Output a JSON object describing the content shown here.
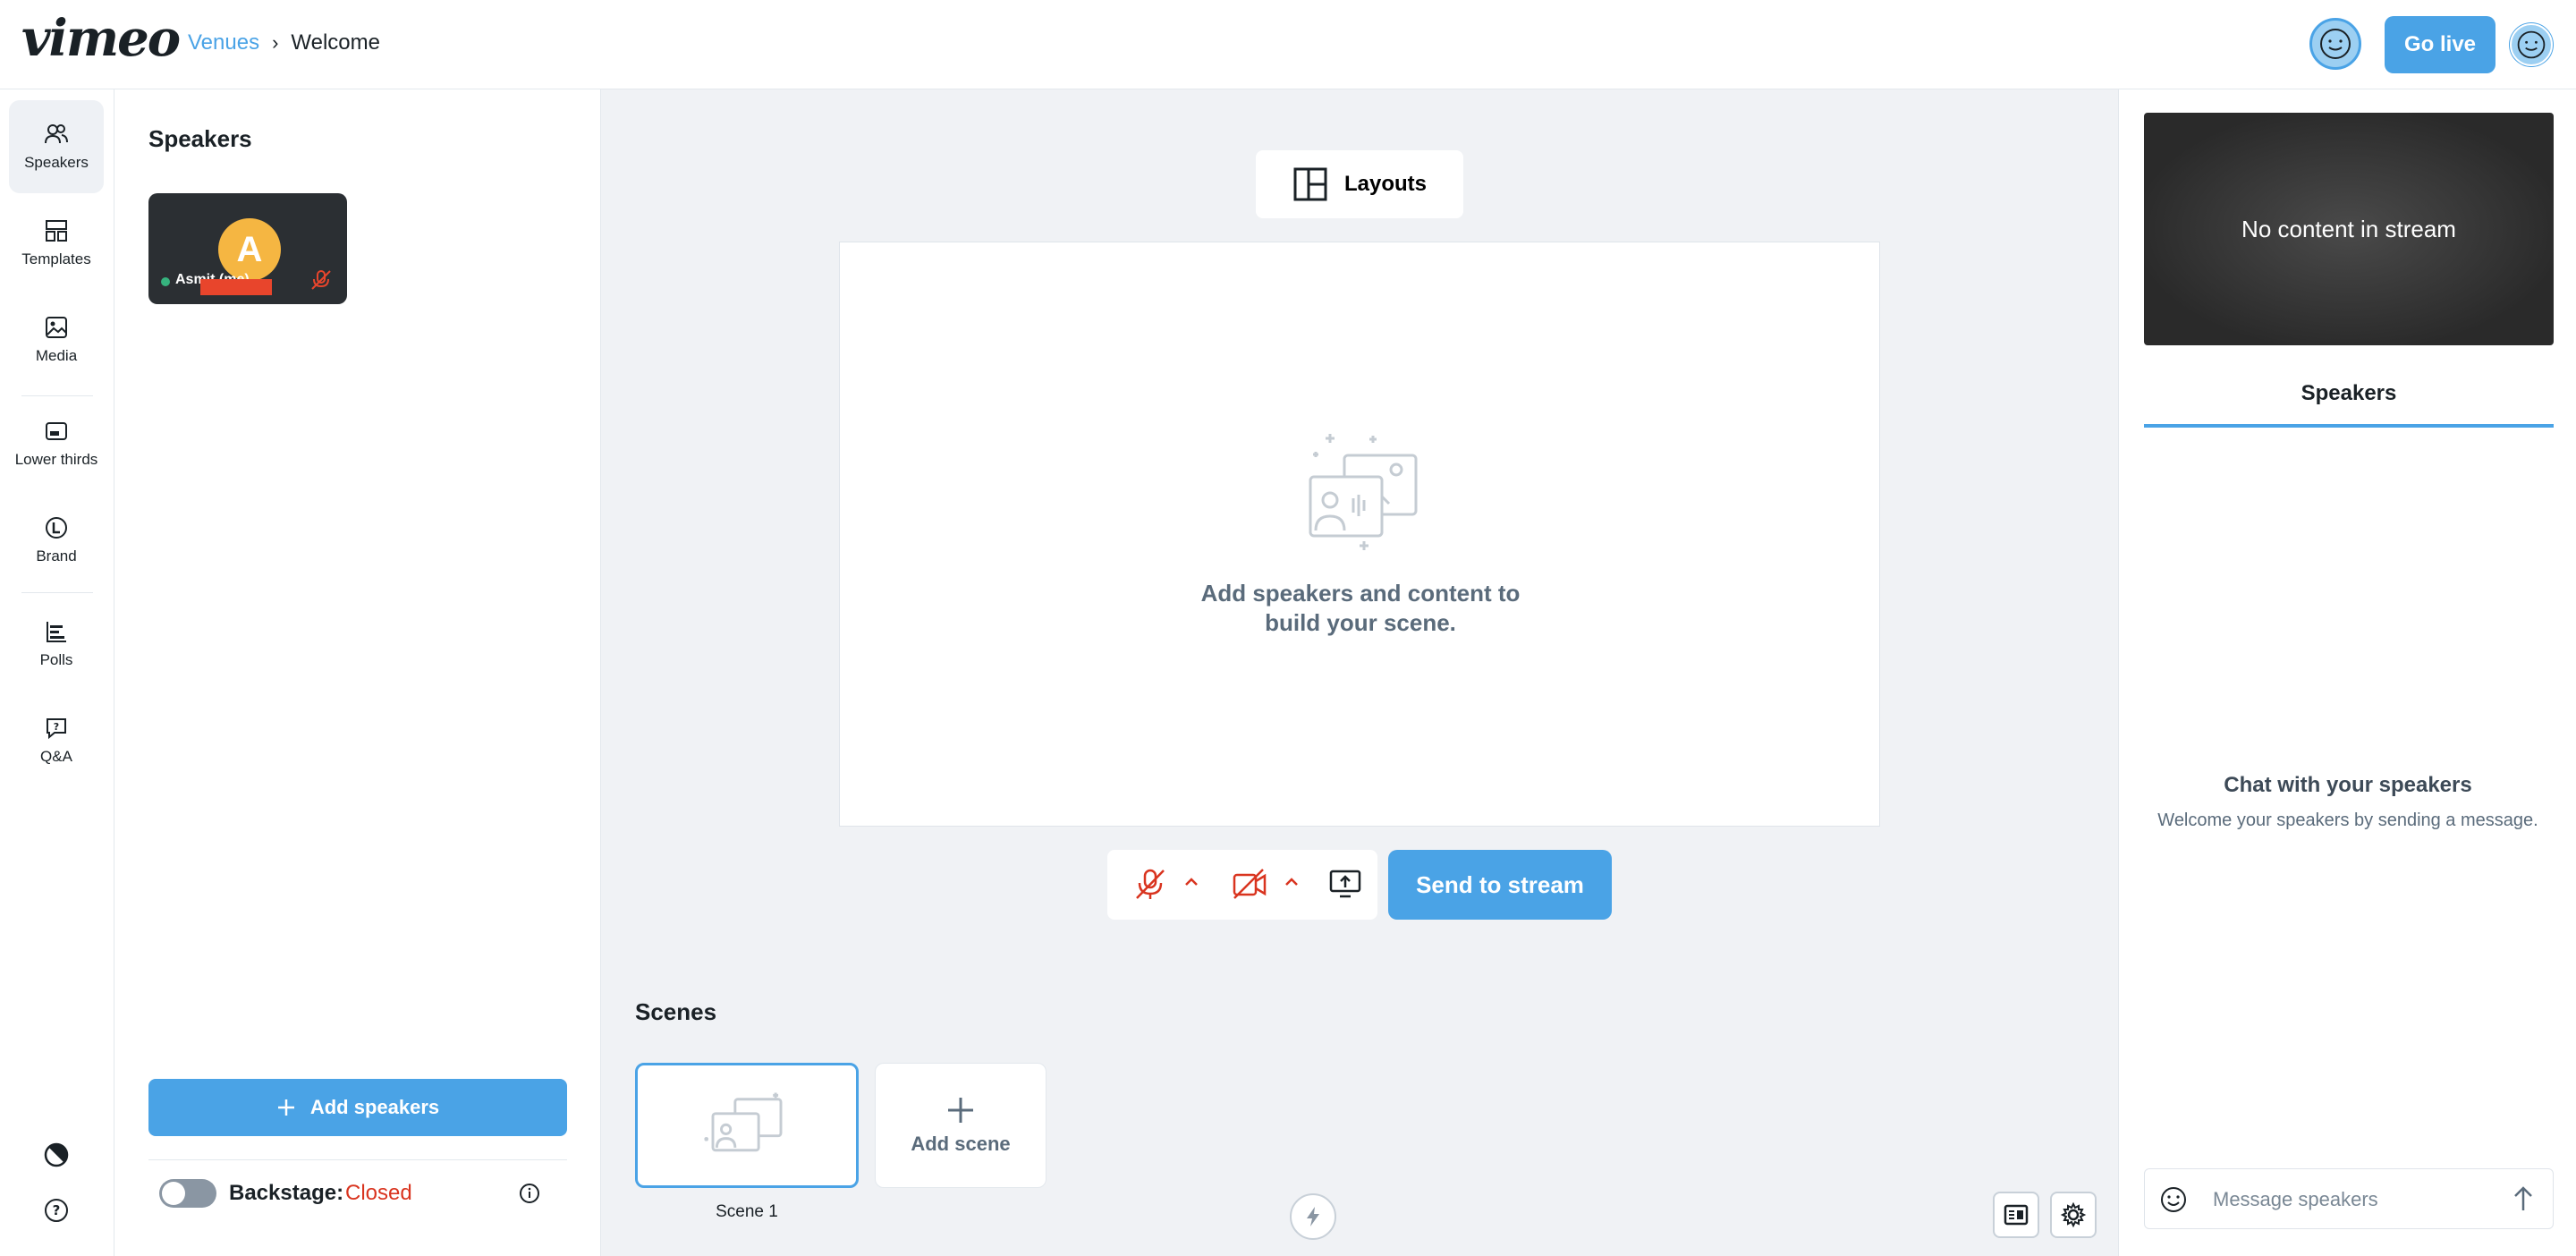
{
  "header": {
    "logo": "vimeo",
    "breadcrumb": {
      "parent": "Venues",
      "separator": "›",
      "current": "Welcome"
    },
    "go_live_label": "Go live"
  },
  "rail": {
    "items": [
      {
        "label": "Speakers",
        "icon": "people-icon",
        "active": true
      },
      {
        "label": "Templates",
        "icon": "templates-icon"
      },
      {
        "label": "Media",
        "icon": "image-icon"
      },
      {
        "label": "Lower thirds",
        "icon": "lower-thirds-icon"
      },
      {
        "label": "Brand",
        "icon": "brand-icon"
      },
      {
        "label": "Polls",
        "icon": "polls-icon"
      },
      {
        "label": "Q&A",
        "icon": "qa-icon"
      }
    ]
  },
  "speakers_panel": {
    "title": "Speakers",
    "speaker": {
      "initial": "A",
      "name": "Asmit (me)"
    },
    "add_label": "Add speakers",
    "backstage_label": "Backstage:",
    "backstage_state": "Closed"
  },
  "stage": {
    "layouts_label": "Layouts",
    "empty_line1": "Add speakers and content to",
    "empty_line2": "build your scene.",
    "send_label": "Send to stream",
    "scenes_title": "Scenes",
    "scenes": [
      {
        "label": "Scene 1"
      }
    ],
    "add_scene_label": "Add scene"
  },
  "right_panel": {
    "preview_text": "No content in stream",
    "tab_label": "Speakers",
    "chat_title": "Chat with your speakers",
    "chat_subtitle": "Welcome your speakers by sending a message.",
    "message_placeholder": "Message speakers"
  },
  "colors": {
    "accent": "#4aa3e6",
    "danger": "#d9341f",
    "stage_bg": "#f0f2f5"
  }
}
